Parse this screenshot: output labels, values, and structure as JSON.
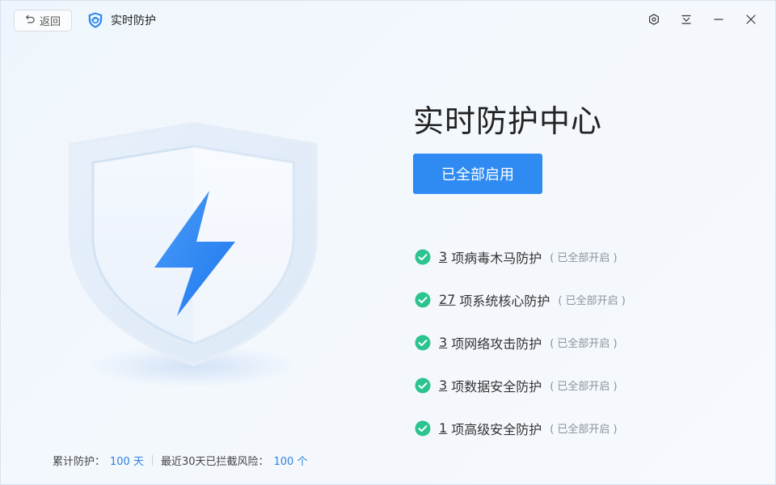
{
  "titlebar": {
    "back_label": "返回",
    "app_name": "实时防护",
    "controls": [
      "settings-icon",
      "menu-icon",
      "minimize-icon",
      "close-icon"
    ]
  },
  "main": {
    "heading": "实时防护中心",
    "enable_button": "已全部启用",
    "items": [
      {
        "count": "3",
        "label": "项病毒木马防护",
        "note": "( 已全部开启 )"
      },
      {
        "count": "27",
        "label": "项系统核心防护",
        "note": "( 已全部开启 )"
      },
      {
        "count": "3",
        "label": "项网络攻击防护",
        "note": "( 已全部开启 )"
      },
      {
        "count": "3",
        "label": "项数据安全防护",
        "note": "( 已全部开启 )"
      },
      {
        "count": "1",
        "label": "项高级安全防护",
        "note": "( 已全部开启 )"
      }
    ]
  },
  "footer": {
    "days_label": "累计防护：",
    "days_value": "100 天",
    "risk_label": "最近30天已拦截风险：",
    "risk_value": "100 个"
  },
  "colors": {
    "accent": "#2f8bf2",
    "check": "#2bc48f",
    "link": "#2f7fe0",
    "bolt": "#2e86f5"
  }
}
